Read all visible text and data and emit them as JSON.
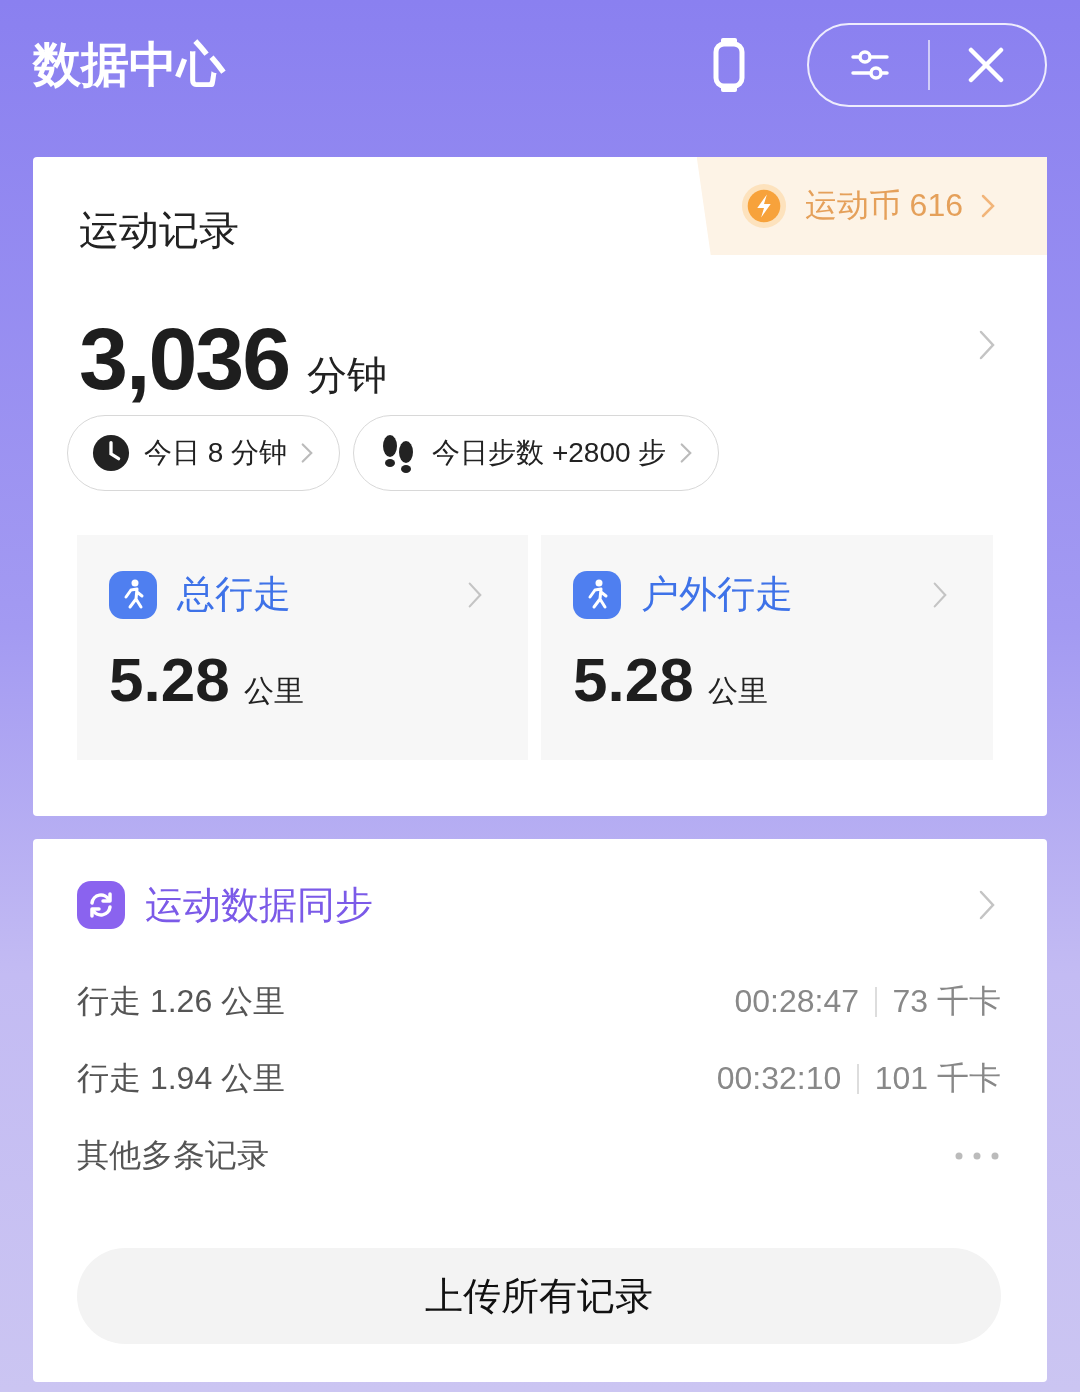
{
  "header": {
    "title": "数据中心"
  },
  "record_card": {
    "title": "运动记录",
    "coin_badge": {
      "label": "运动币 616"
    },
    "total": {
      "value": "3,036",
      "unit": "分钟"
    },
    "chips": [
      {
        "kind": "time",
        "label": "今日 8 分钟"
      },
      {
        "kind": "steps",
        "label": "今日步数 +2800 步"
      }
    ],
    "tiles": [
      {
        "title": "总行走",
        "value": "5.28",
        "unit": "公里"
      },
      {
        "title": "户外行走",
        "value": "5.28",
        "unit": "公里"
      }
    ]
  },
  "sync_card": {
    "title": "运动数据同步",
    "records": [
      {
        "kind": "entry",
        "label": "行走 1.26 公里",
        "duration": "00:28:47",
        "calories": "73 千卡"
      },
      {
        "kind": "entry",
        "label": "行走 1.94 公里",
        "duration": "00:32:10",
        "calories": "101 千卡"
      },
      {
        "kind": "more",
        "label": "其他多条记录"
      }
    ],
    "button": "上传所有记录"
  }
}
